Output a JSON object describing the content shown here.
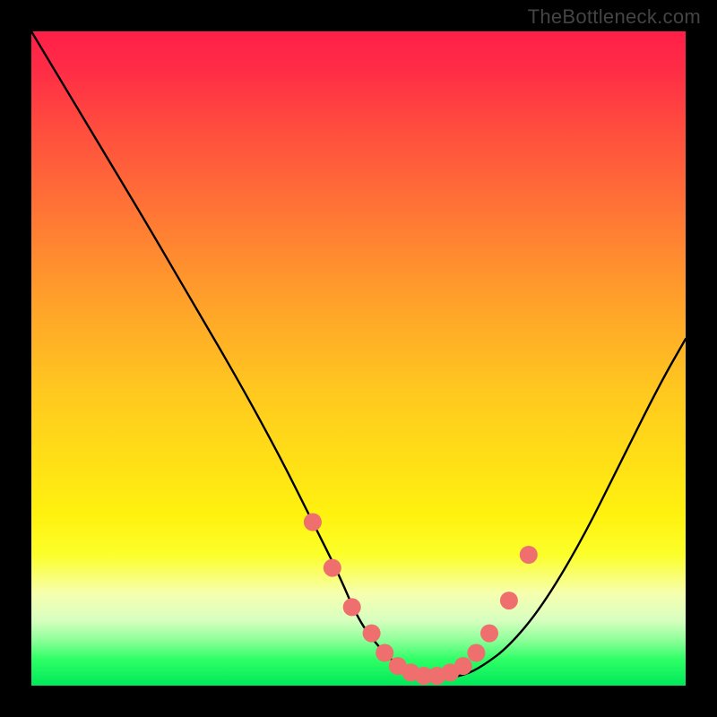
{
  "watermark": "TheBottleneck.com",
  "chart_data": {
    "type": "line",
    "title": "",
    "xlabel": "",
    "ylabel": "",
    "xlim": [
      0,
      100
    ],
    "ylim": [
      0,
      100
    ],
    "series": [
      {
        "name": "curve",
        "x": [
          0,
          6,
          12,
          18,
          25,
          32,
          38,
          43,
          47,
          50,
          53,
          56,
          59,
          62,
          66,
          69,
          73,
          78,
          84,
          90,
          96,
          100
        ],
        "values": [
          100,
          90,
          80,
          70,
          58,
          46,
          35,
          25,
          17,
          10,
          6,
          3,
          1.5,
          1,
          1.5,
          3,
          6,
          12,
          22,
          34,
          46,
          53
        ]
      }
    ],
    "markers": {
      "name": "dots",
      "color": "#ef6f6f",
      "radius": 10,
      "x": [
        43,
        46,
        49,
        52,
        54,
        56,
        58,
        60,
        62,
        64,
        66,
        68,
        70,
        73,
        76
      ],
      "values": [
        25,
        18,
        12,
        8,
        5,
        3,
        2,
        1.5,
        1.5,
        2,
        3,
        5,
        8,
        13,
        20
      ]
    },
    "background_gradient": {
      "top": "#ff1f49",
      "mid": "#ffe016",
      "bottom": "#00e85a"
    }
  }
}
